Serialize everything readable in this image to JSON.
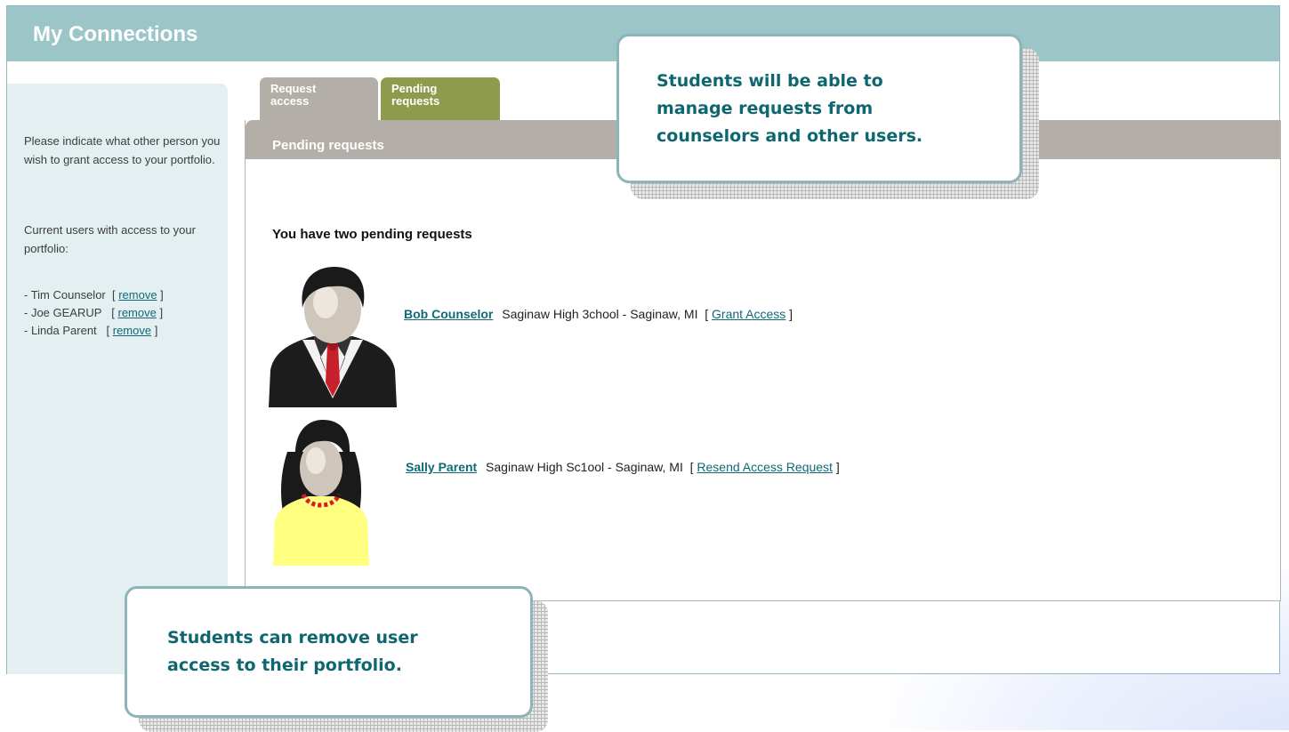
{
  "header": {
    "title": "My Connections"
  },
  "sidebar": {
    "instruction": "Please indicate what other person you wish to grant access to your portfolio.",
    "current_users_label": "Current users with access to your portfolio:",
    "users": [
      {
        "prefix": "- Tim Counselor",
        "action": "remove"
      },
      {
        "prefix": "- Joe GEARUP",
        "action": "remove"
      },
      {
        "prefix": "- Linda Parent",
        "action": "remove"
      }
    ]
  },
  "tabs": [
    {
      "label": "Request access",
      "active": false
    },
    {
      "label": "Pending requests",
      "active": true
    }
  ],
  "panel": {
    "title": "Pending requests",
    "heading": "You have two pending requests",
    "requests": [
      {
        "name": "Bob Counselor",
        "school": "Saginaw High 3chool - Saginaw, MI",
        "action": "Grant Access",
        "avatar": "male-counselor-avatar"
      },
      {
        "name": "Sally Parent",
        "school": "Saginaw High Sc1ool - Saginaw, MI",
        "action": "Resend Access Request",
        "avatar": "female-parent-avatar"
      }
    ]
  },
  "callouts": {
    "top": "Students will be able to manage requests from counselors and other users.",
    "bottom": "Students can remove user access to their portfolio."
  },
  "colors": {
    "header": "#9cc5c8",
    "sidebar": "#e4eff1",
    "tab_inactive": "#b3aea7",
    "tab_active": "#8e9a4c",
    "link": "#0f6a76",
    "callout_text": "#0e6770"
  }
}
